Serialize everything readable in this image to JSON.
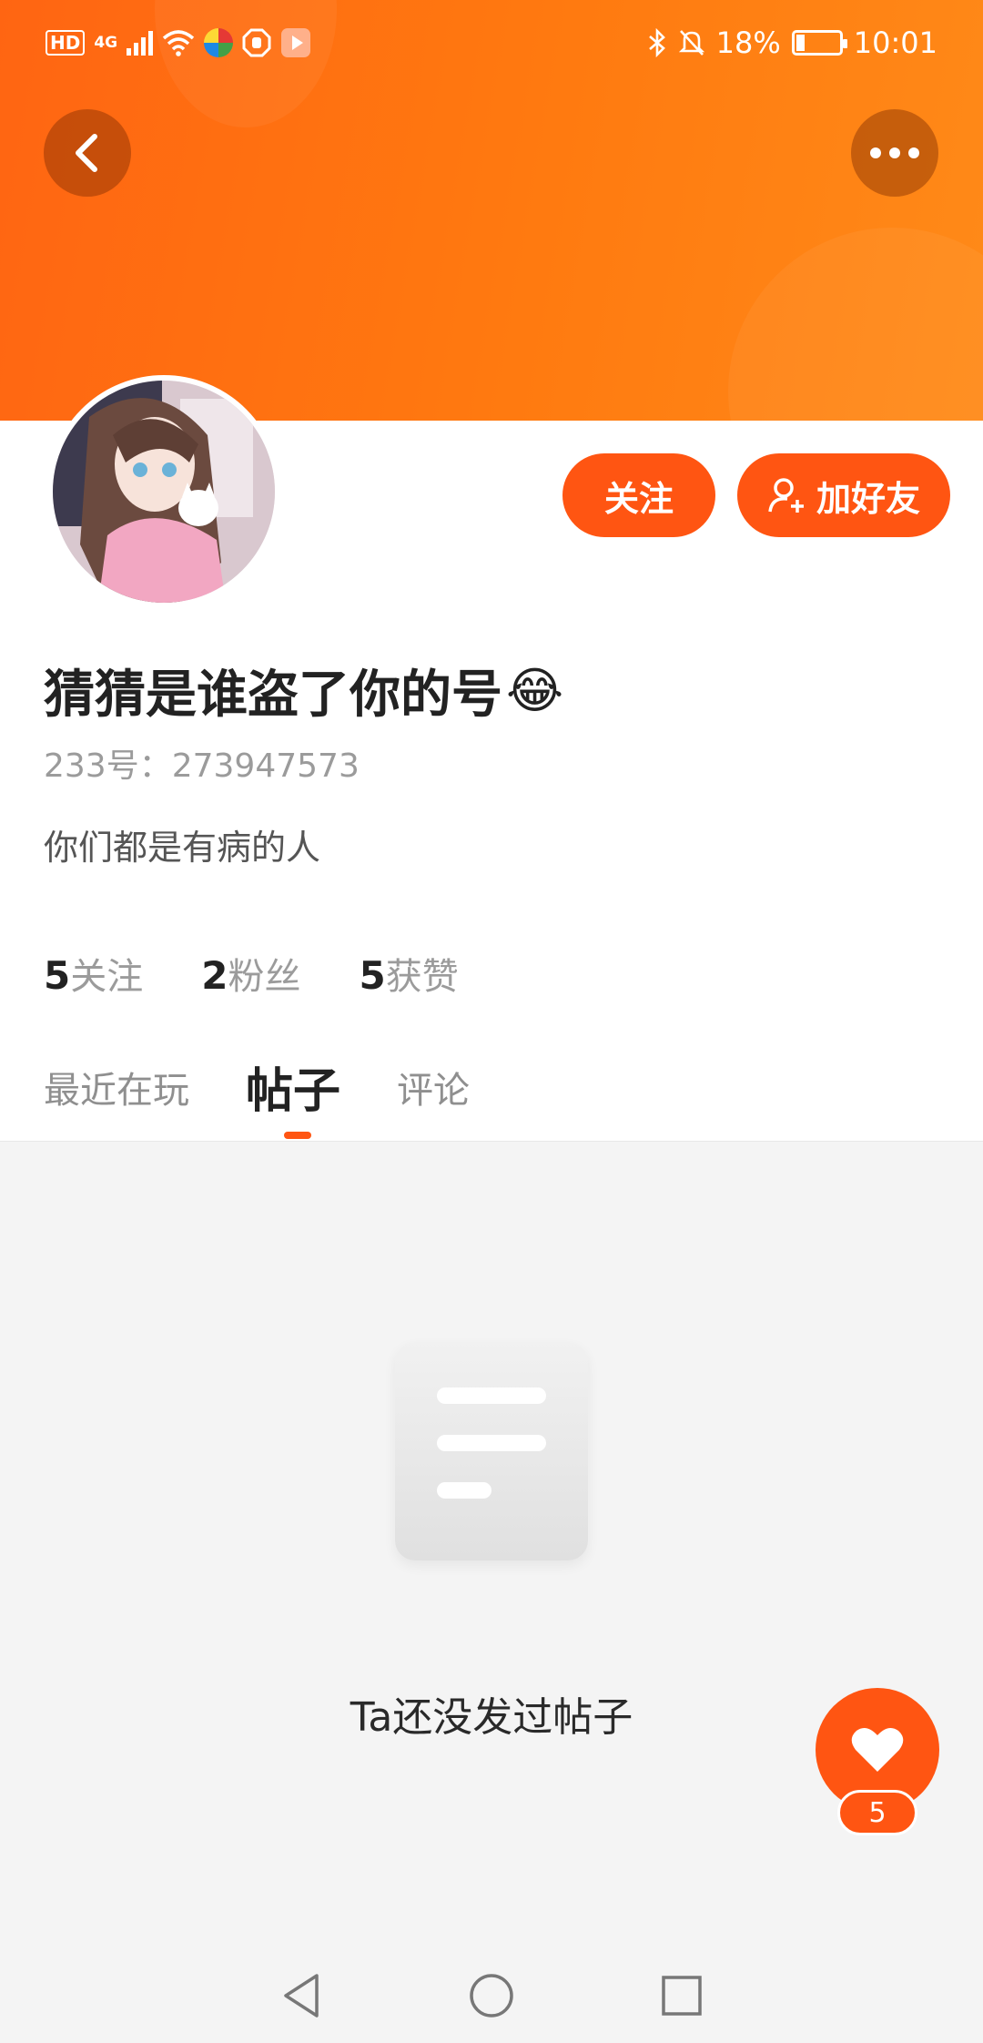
{
  "status_bar": {
    "hd": "HD",
    "network": "4G",
    "battery_percent": "18%",
    "battery_level": 0.18,
    "time": "10:01"
  },
  "header": {
    "back_icon": "chevron-left-icon",
    "more_icon": "more-dots-icon",
    "gradient_start": "#ff6512",
    "gradient_end": "#ff8a18"
  },
  "profile": {
    "username": "猜猜是谁盗了你的号",
    "username_emoji": "😂",
    "uid": "233号：273947573",
    "bio": "你们都是有病的人",
    "follow_label": "关注",
    "add_friend_label": "加好友"
  },
  "stats": [
    {
      "value": "5",
      "label": "关注"
    },
    {
      "value": "2",
      "label": "粉丝"
    },
    {
      "value": "5",
      "label": "获赞"
    }
  ],
  "tabs": [
    {
      "label": "最近在玩",
      "active": false
    },
    {
      "label": "帖子",
      "active": true
    },
    {
      "label": "评论",
      "active": false
    }
  ],
  "empty_state": {
    "message": "Ta还没发过帖子"
  },
  "like_fab": {
    "count": "5",
    "icon": "heart-icon"
  },
  "accent_color": "#ff5512"
}
